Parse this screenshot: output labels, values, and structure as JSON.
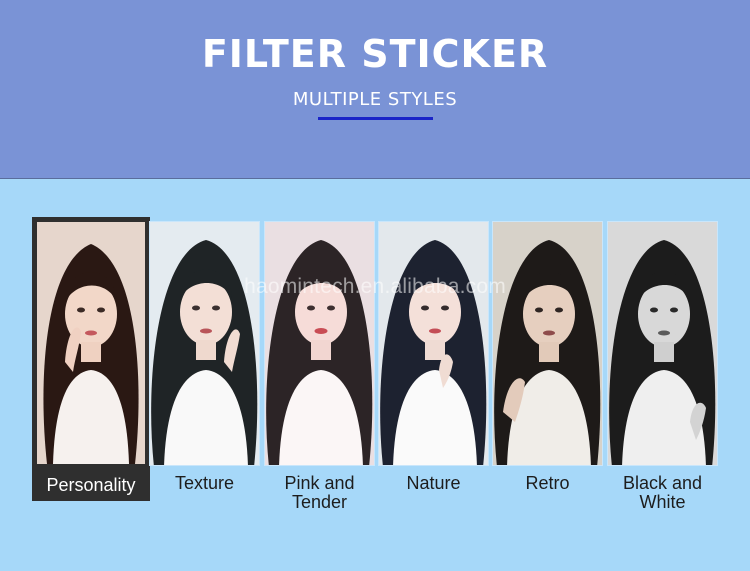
{
  "header": {
    "title": "FILTER STICKER",
    "subtitle": "MULTIPLE STYLES",
    "background": "#7a93d6",
    "underline_color": "#1a24c8"
  },
  "panel": {
    "background": "#a6d8f9"
  },
  "watermark": "haomintech.en.alibaba.com",
  "filters": [
    {
      "label": "Personality",
      "selected": true
    },
    {
      "label": "Texture",
      "selected": false
    },
    {
      "label": "Pink and Tender",
      "selected": false
    },
    {
      "label": "Nature",
      "selected": false
    },
    {
      "label": "Retro",
      "selected": false
    },
    {
      "label": "Black and White",
      "selected": false
    }
  ]
}
